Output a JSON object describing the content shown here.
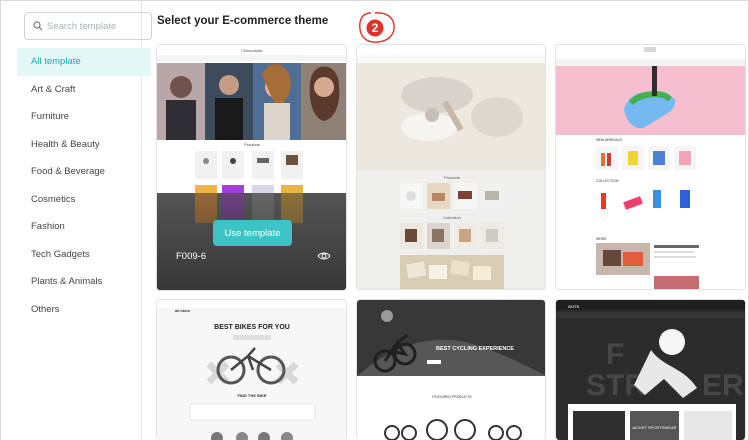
{
  "search": {
    "placeholder": "Search template"
  },
  "categories": [
    {
      "label": "All template",
      "active": true
    },
    {
      "label": "Art & Craft"
    },
    {
      "label": "Furniture"
    },
    {
      "label": "Health & Beauty"
    },
    {
      "label": "Food & Beverage"
    },
    {
      "label": "Cosmetics"
    },
    {
      "label": "Fashion"
    },
    {
      "label": "Tech Gadgets"
    },
    {
      "label": "Plants & Animals"
    },
    {
      "label": "Others"
    }
  ],
  "main": {
    "heading": "Select your E-commerce theme",
    "step_number": "2"
  },
  "cards": {
    "first": {
      "site_name": "Classicstudio",
      "section_title": "Products",
      "use_button": "Use template",
      "code": "F009-6"
    },
    "second": {
      "section_products": "Products",
      "section_collection": "Collection"
    },
    "third": {
      "section_new": "NEW ARRIVALS",
      "section_collection": "COLLECTION",
      "section_news": "NEWS"
    },
    "fourth": {
      "logo": "all.store",
      "headline": "BEST BIKES FOR YOU",
      "find": "FIND THE BIKE"
    },
    "fifth": {
      "headline": "BEST CYCLING EXPERIENCE",
      "featured": "FEATURED PRODUCTS"
    },
    "sixth": {
      "logo": "GUTS",
      "headline_a": "F",
      "headline_b": "STR",
      "headline_c": "ER",
      "sub": "JACKET SPORTSWEAR"
    }
  }
}
